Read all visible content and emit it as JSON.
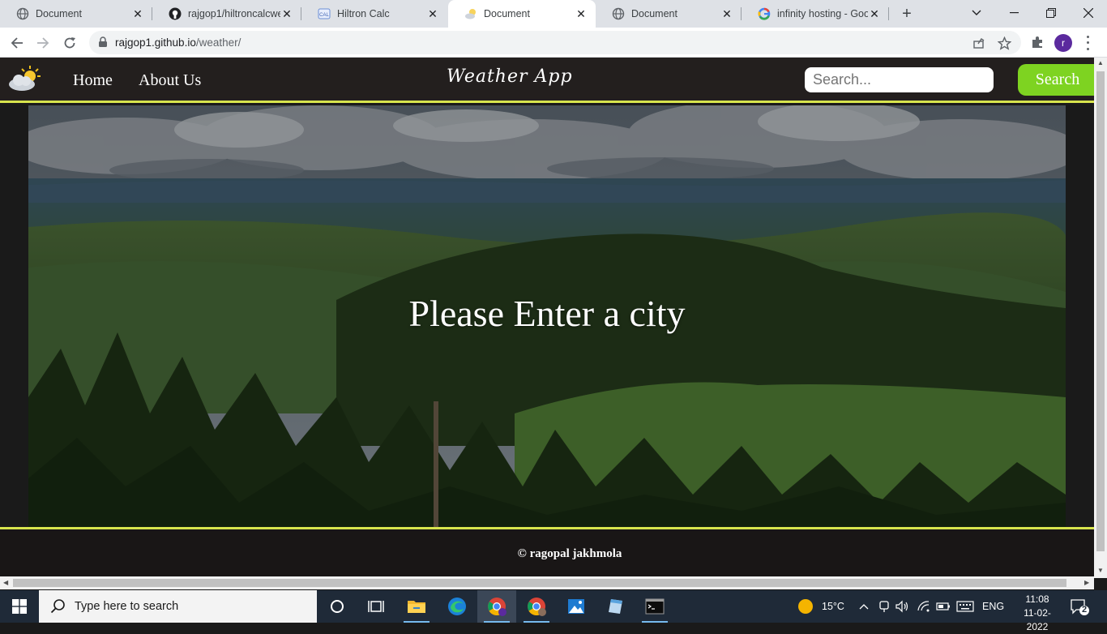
{
  "browser": {
    "tabs": [
      {
        "title": "Document",
        "icon": "globe-icon",
        "active": false
      },
      {
        "title": "rajgop1/hiltroncalcwe",
        "icon": "github-icon",
        "active": false
      },
      {
        "title": "Hiltron Calc",
        "icon": "calc-icon",
        "active": false
      },
      {
        "title": "Document",
        "icon": "weather-icon",
        "active": true
      },
      {
        "title": "Document",
        "icon": "globe-icon",
        "active": false
      },
      {
        "title": "infinity hosting - Goo",
        "icon": "google-icon",
        "active": false
      }
    ],
    "url_host": "rajgop1.github.io",
    "url_path": "/weather/",
    "profile_initial": "r"
  },
  "page": {
    "nav": {
      "home": "Home",
      "about": "About Us",
      "brand": "Weather App",
      "search_placeholder": "Search...",
      "search_button": "Search"
    },
    "hero_message": "Please Enter a city",
    "footer": "© ragopal jakhmola"
  },
  "taskbar": {
    "search_placeholder": "Type here to search",
    "weather": "15°C",
    "language": "ENG",
    "time": "11:08",
    "date": "11-02-2022",
    "notifications": "2"
  },
  "colors": {
    "accent_line": "#d7e44d",
    "search_button": "#7ed321",
    "nav_bg": "#231f1e"
  }
}
